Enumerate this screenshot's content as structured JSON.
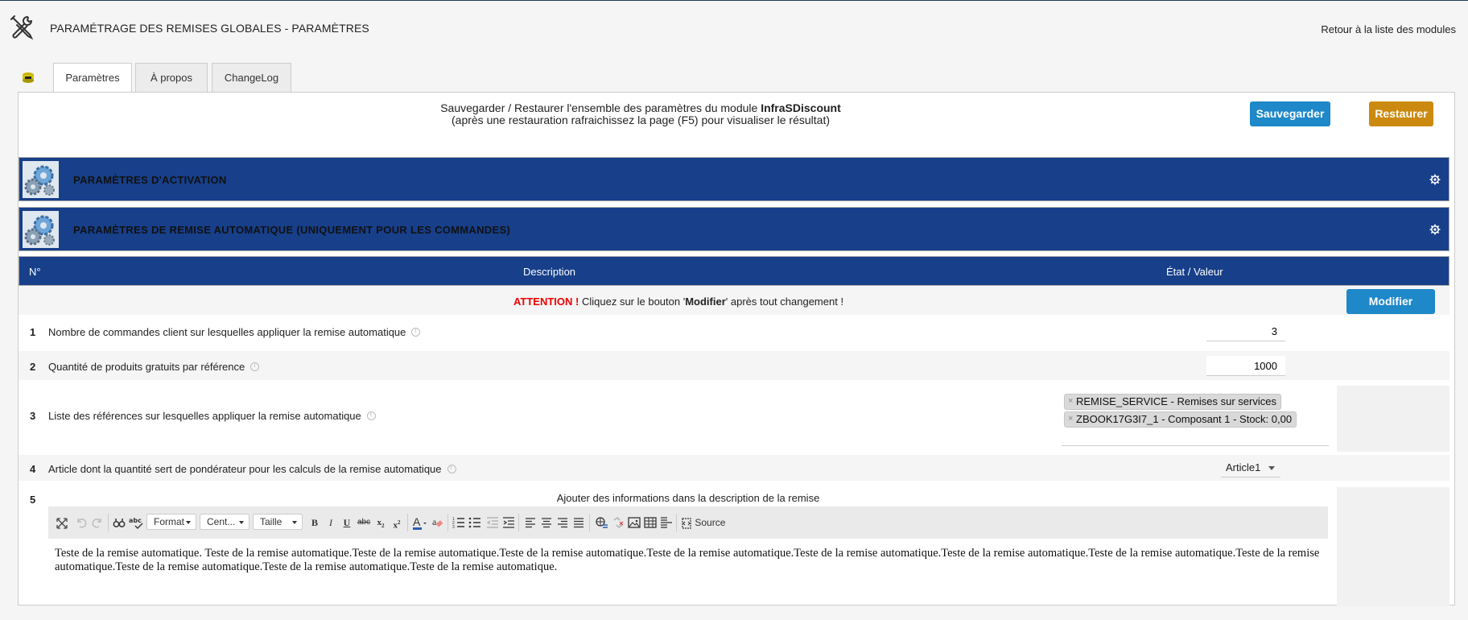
{
  "header": {
    "title": "PARAMÉTRAGE DES REMISES GLOBALES - PARAMÈTRES",
    "back_link": "Retour à la liste des modules"
  },
  "tabs": [
    {
      "label": "Paramètres",
      "active": true
    },
    {
      "label": "À propos",
      "active": false
    },
    {
      "label": "ChangeLog",
      "active": false
    }
  ],
  "backup": {
    "line1_prefix": "Sauvegarder / Restaurer l'ensemble des paramètres du module ",
    "module_name": "InfraSDiscount",
    "line2": "(après une restauration rafraichissez la page (F5) pour visualiser le résultat)",
    "save_label": "Sauvegarder",
    "restore_label": "Restaurer"
  },
  "sections": [
    {
      "title": "PARAMÈTRES D'ACTIVATION",
      "icon": "gears-icon"
    },
    {
      "title": "PARAMÈTRES DE REMISE AUTOMATIQUE (UNIQUEMENT POUR LES COMMANDES)",
      "icon": "gears-icon"
    }
  ],
  "table": {
    "col_no": "N°",
    "col_desc": "Description",
    "col_value": "État / Valeur"
  },
  "attention": {
    "word": "ATTENTION !",
    "text_before": " Cliquez sur le bouton '",
    "button_ref": "Modifier",
    "text_after": "' après tout changement !",
    "modify_label": "Modifier"
  },
  "rows": [
    {
      "no": "1",
      "label": "Nombre de commandes client sur lesquelles appliquer la remise automatique",
      "value": "3"
    },
    {
      "no": "2",
      "label": "Quantité de produits gratuits par référence",
      "value": "1000"
    },
    {
      "no": "3",
      "label": "Liste des références sur lesquelles appliquer la remise automatique",
      "tags": [
        "REMISE_SERVICE - Remises sur services",
        "ZBOOK17G3I7_1 - Composant 1 - Stock: 0,00"
      ]
    },
    {
      "no": "4",
      "label": "Article dont la quantité sert de pondérateur pour les calculs de la remise automatique",
      "selected": "Article1"
    },
    {
      "no": "5",
      "caption": "Ajouter des informations dans la description de la remise"
    }
  ],
  "editor": {
    "format_label": "Format",
    "font_label": "Cent...",
    "size_label": "Taille",
    "source_label": "Source",
    "content": "Teste de la remise automatique. Teste de la remise automatique.Teste de la remise automatique.Teste de la remise automatique.Teste de la remise automatique.Teste de la remise automatique.Teste de la remise automatique.Teste de la remise automatique.Teste de la remise automatique.Teste de la remise automatique.Teste de la remise automatique.Teste de la remise automatique."
  }
}
